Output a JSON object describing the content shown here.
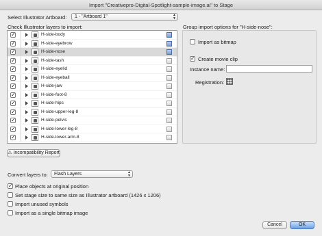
{
  "window": {
    "title": "Import \"Creativepro-Digital-Spotlight-sample-image.ai\" to Stage"
  },
  "artboard": {
    "label": "Select Illustrator Artboard:",
    "selected": "1 - \"Artboard 1\""
  },
  "layers": {
    "label": "Check Illustrator layers to import:",
    "items": [
      {
        "name": "H-side-body",
        "checked": true,
        "selected": false
      },
      {
        "name": "H-side-eyebrow",
        "checked": true,
        "selected": false
      },
      {
        "name": "H-side-nose",
        "checked": true,
        "selected": true
      },
      {
        "name": "H-side-tash",
        "checked": true,
        "selected": false
      },
      {
        "name": "H-side-eyelid",
        "checked": true,
        "selected": false
      },
      {
        "name": "H-side-eyeball",
        "checked": true,
        "selected": false
      },
      {
        "name": "H-side-jaw",
        "checked": true,
        "selected": false
      },
      {
        "name": "H-side-foot-8",
        "checked": true,
        "selected": false
      },
      {
        "name": "H-side-hips",
        "checked": true,
        "selected": false
      },
      {
        "name": "H-side-upper-leg-8",
        "checked": true,
        "selected": false
      },
      {
        "name": "H-side-pelvis",
        "checked": true,
        "selected": false
      },
      {
        "name": "H-side-lower-leg-8",
        "checked": true,
        "selected": false
      },
      {
        "name": "H-side-lower-arm-8",
        "checked": true,
        "selected": false
      }
    ]
  },
  "group_options": {
    "label": "Group import options for \"H-side-nose\":",
    "import_as_bitmap": {
      "label": "Import as bitmap",
      "checked": false
    },
    "create_movie_clip": {
      "label": "Create movie clip",
      "checked": true
    },
    "instance_name": {
      "label": "Instance name:",
      "value": ""
    },
    "registration": {
      "label": "Registration:"
    }
  },
  "incompat_button": "Incompatibility Report",
  "convert_layers": {
    "label": "Convert layers to:",
    "selected": "Flash Layers"
  },
  "options": [
    {
      "label": "Place objects at original position",
      "checked": true
    },
    {
      "label": "Set stage size to same size as Illustrator artboard (1426 x 1206)",
      "checked": false
    },
    {
      "label": "Import unused symbols",
      "checked": false
    },
    {
      "label": "Import as a single bitmap image",
      "checked": false
    }
  ],
  "buttons": {
    "cancel": "Cancel",
    "ok": "OK"
  }
}
